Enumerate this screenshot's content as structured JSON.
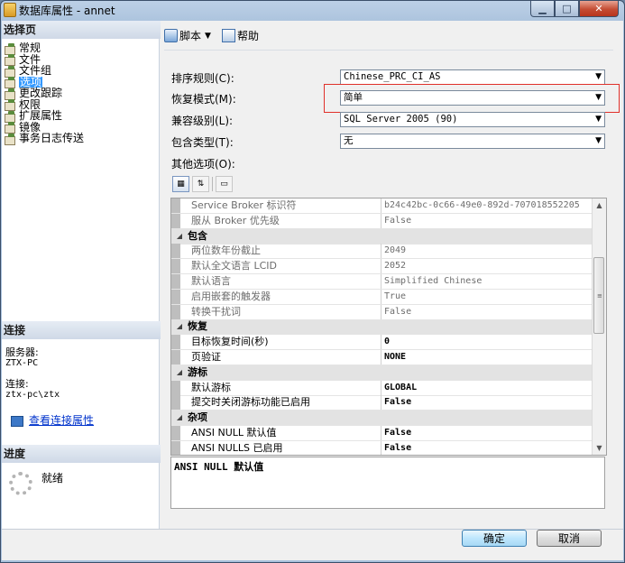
{
  "window": {
    "title": "数据库属性 - annet"
  },
  "left": {
    "select_page_header": "选择页",
    "pages": [
      {
        "label": "常规",
        "selected": false
      },
      {
        "label": "文件",
        "selected": false
      },
      {
        "label": "文件组",
        "selected": false
      },
      {
        "label": "选项",
        "selected": true
      },
      {
        "label": "更改跟踪",
        "selected": false
      },
      {
        "label": "权限",
        "selected": false
      },
      {
        "label": "扩展属性",
        "selected": false
      },
      {
        "label": "镜像",
        "selected": false
      },
      {
        "label": "事务日志传送",
        "selected": false
      }
    ],
    "connection_header": "连接",
    "server_label": "服务器:",
    "server_value": "ZTX-PC",
    "connection_label": "连接:",
    "connection_value": "ztx-pc\\ztx",
    "view_conn_props": "查看连接属性",
    "progress_header": "进度",
    "progress_status": "就绪"
  },
  "toolbar": {
    "script_label": "脚本",
    "help_label": "帮助"
  },
  "form": {
    "collation_label": "排序规则(C):",
    "collation_value": "Chinese_PRC_CI_AS",
    "recovery_label": "恢复模式(M):",
    "recovery_value": "简单",
    "compat_label": "兼容级别(L):",
    "compat_value": "SQL Server 2005 (90)",
    "containment_label": "包含类型(T):",
    "containment_value": "无",
    "other_label": "其他选项(O):"
  },
  "grid": {
    "rows": [
      {
        "kind": "prop",
        "name": "Service Broker 标识符",
        "value": "b24c42bc-0c66-49e0-892d-707018552205",
        "gray": true
      },
      {
        "kind": "prop",
        "name": "服从 Broker 优先级",
        "value": "False",
        "gray": true
      },
      {
        "kind": "cat",
        "name": "包含"
      },
      {
        "kind": "prop",
        "name": "两位数年份截止",
        "value": "2049",
        "gray": true
      },
      {
        "kind": "prop",
        "name": "默认全文语言 LCID",
        "value": "2052",
        "gray": true
      },
      {
        "kind": "prop",
        "name": "默认语言",
        "value": "Simplified Chinese",
        "gray": true
      },
      {
        "kind": "prop",
        "name": "启用嵌套的触发器",
        "value": "True",
        "gray": true
      },
      {
        "kind": "prop",
        "name": "转换干扰词",
        "value": "False",
        "gray": true
      },
      {
        "kind": "cat",
        "name": "恢复"
      },
      {
        "kind": "prop",
        "name": "目标恢复时间(秒)",
        "value": "0",
        "gray": false,
        "bold": true
      },
      {
        "kind": "prop",
        "name": "页验证",
        "value": "NONE",
        "gray": false,
        "bold": true
      },
      {
        "kind": "cat",
        "name": "游标"
      },
      {
        "kind": "prop",
        "name": "默认游标",
        "value": "GLOBAL",
        "gray": false,
        "bold": true
      },
      {
        "kind": "prop",
        "name": "提交时关闭游标功能已启用",
        "value": "False",
        "gray": false,
        "bold": true
      },
      {
        "kind": "cat",
        "name": "杂项"
      },
      {
        "kind": "prop",
        "name": "ANSI NULL 默认值",
        "value": "False",
        "gray": false,
        "bold": true
      },
      {
        "kind": "prop",
        "name": "ANSI NULLS 已启用",
        "value": "False",
        "gray": false,
        "bold": true
      }
    ]
  },
  "description": "ANSI NULL 默认值",
  "buttons": {
    "ok": "确定",
    "cancel": "取消"
  }
}
